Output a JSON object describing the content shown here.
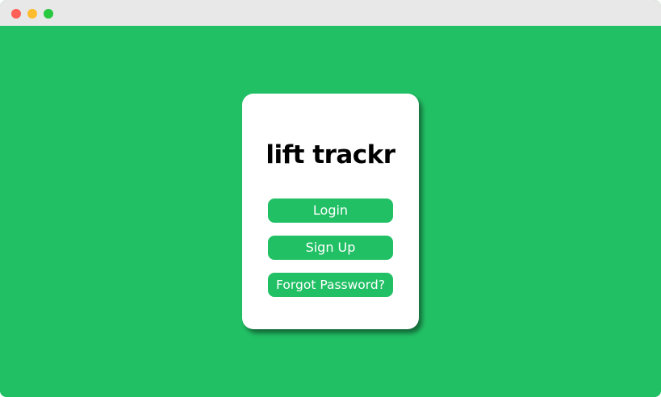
{
  "window": {
    "controls": [
      "close",
      "minimize",
      "maximize"
    ]
  },
  "colors": {
    "background": "#22c065",
    "card": "#ffffff",
    "button": "#22c065",
    "button_text": "#ffffff",
    "title_text": "#000000"
  },
  "card": {
    "title": "lift trackr",
    "buttons": {
      "login": "Login",
      "signup": "Sign Up",
      "forgot": "Forgot Password?"
    }
  }
}
